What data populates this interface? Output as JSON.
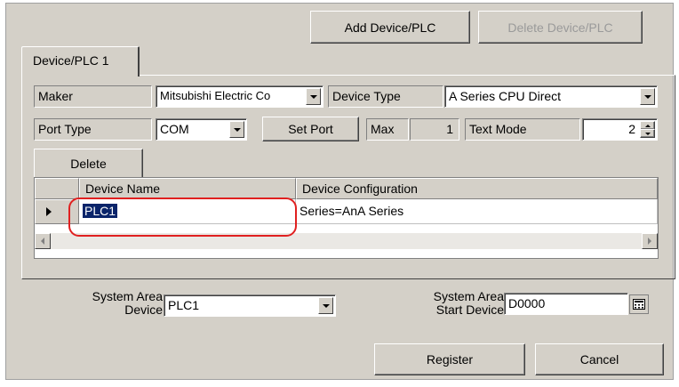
{
  "toolbar": {
    "add_device_label": "Add Device/PLC",
    "delete_device_label": "Delete Device/PLC"
  },
  "tab": {
    "label": "Device/PLC 1"
  },
  "row1": {
    "maker_label": "Maker",
    "maker_value": "Mitsubishi Electric Co",
    "device_type_label": "Device Type",
    "device_type_value": "A Series CPU Direct"
  },
  "row2": {
    "port_type_label": "Port Type",
    "port_type_value": "COM",
    "set_port_label": "Set Port",
    "max_label": "Max",
    "max_value": "1",
    "text_mode_label": "Text Mode",
    "text_mode_value": "2"
  },
  "delete_button_label": "Delete",
  "grid": {
    "columns": [
      "Device Name",
      "Device Configuration"
    ],
    "rows": [
      {
        "device_name": "PLC1",
        "device_configuration": "Series=AnA Series"
      }
    ]
  },
  "system_area": {
    "device_label_line1": "System Area",
    "device_label_line2": "Device",
    "device_value": "PLC1",
    "start_label_line1": "System Area",
    "start_label_line2": "Start Device",
    "start_value": "D0000"
  },
  "footer": {
    "register_label": "Register",
    "cancel_label": "Cancel"
  },
  "colors": {
    "dialog_bg": "#d4d0c8",
    "selection": "#0a246a",
    "highlight_annotation": "#e02020"
  },
  "icons": [
    "dropdown-arrow-icon",
    "spin-up-icon",
    "spin-down-icon",
    "row-pointer-icon",
    "scroll-left-icon",
    "scroll-right-icon",
    "keypad-icon"
  ]
}
